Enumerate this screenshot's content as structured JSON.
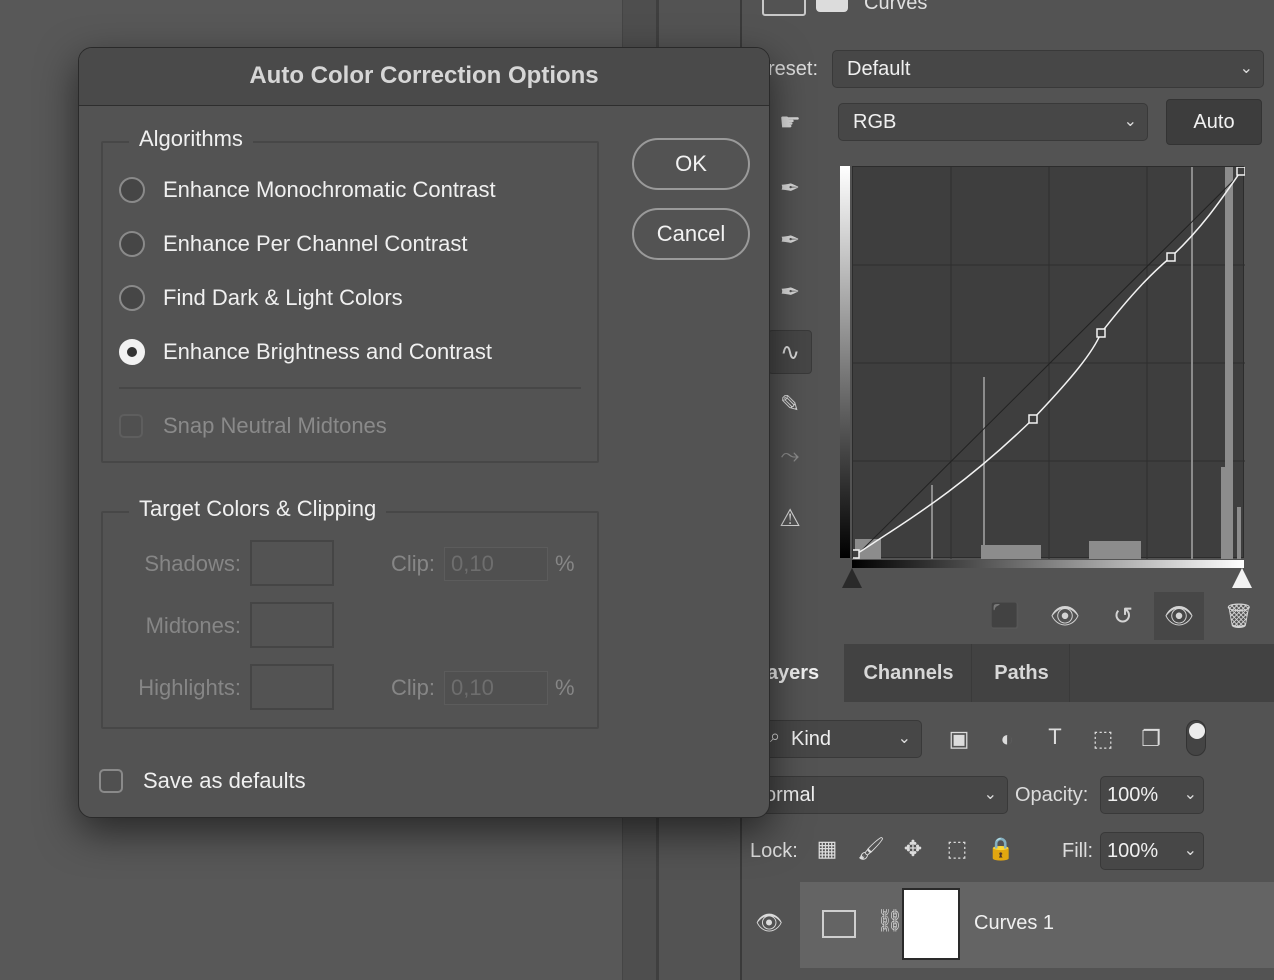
{
  "dialog": {
    "title": "Auto Color Correction Options",
    "algorithms_legend": "Algorithms",
    "algorithms": [
      {
        "label": "Enhance Monochromatic Contrast",
        "selected": false
      },
      {
        "label": "Enhance Per Channel Contrast",
        "selected": false
      },
      {
        "label": "Find Dark & Light Colors",
        "selected": false
      },
      {
        "label": "Enhance Brightness and Contrast",
        "selected": true
      }
    ],
    "snap_label": "Snap Neutral Midtones",
    "target_legend": "Target Colors & Clipping",
    "shadows_label": "Shadows:",
    "midtones_label": "Midtones:",
    "highlights_label": "Highlights:",
    "clip_label": "Clip:",
    "shadows_clip": "0,10",
    "highlights_clip": "0,10",
    "percent": "%",
    "save_defaults_label": "Save as defaults",
    "ok_label": "OK",
    "cancel_label": "Cancel"
  },
  "properties": {
    "title": "Curves",
    "preset_label": "reset:",
    "preset_value": "Default",
    "channel_value": "RGB",
    "auto_label": "Auto"
  },
  "layers": {
    "tabs": [
      "ayers",
      "Channels",
      "Paths"
    ],
    "kind_label": "Kind",
    "blend_mode": "ormal",
    "opacity_label": "Opacity:",
    "opacity_value": "100%",
    "lock_label": "Lock:",
    "fill_label": "Fill:",
    "fill_value": "100%",
    "layer_name": "Curves 1"
  },
  "colors": {
    "panel_bg": "#535353",
    "dialog_title_bg": "#4a4a4a",
    "accent_white": "#ffffff"
  }
}
